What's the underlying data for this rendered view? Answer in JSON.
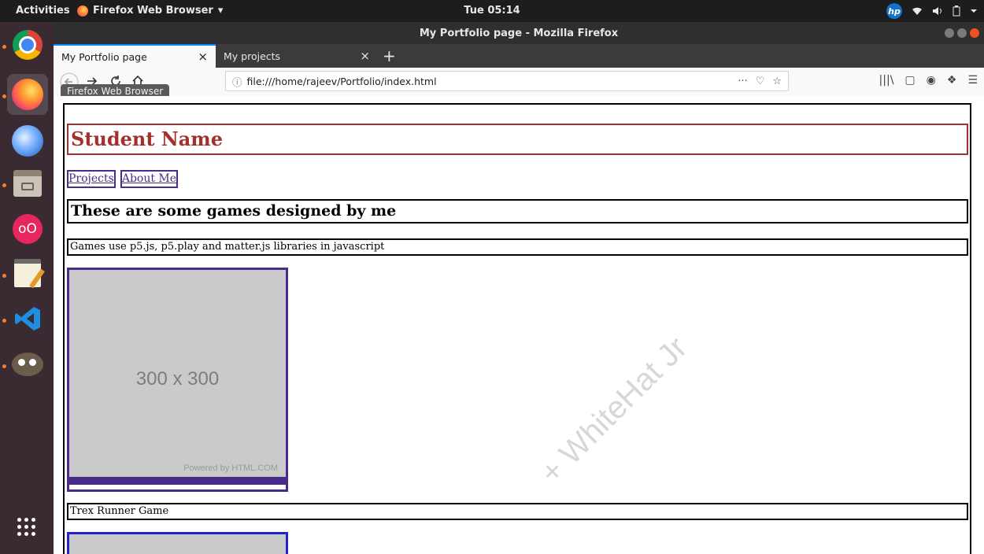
{
  "topbar": {
    "activities": "Activities",
    "app_menu_label": "Firefox Web Browser",
    "app_menu_arrow": "▾",
    "clock": "Tue 05:14",
    "tray_logo": "hp",
    "tray_icons": [
      "wifi-icon",
      "volume-icon",
      "battery-icon",
      "menu-arrow-icon"
    ]
  },
  "dock": {
    "items": [
      "chrome",
      "firefox",
      "thunderbird",
      "files",
      "oo",
      "text-editor",
      "vscode",
      "gimp"
    ],
    "oo_label": "oO"
  },
  "window": {
    "title": "My Portfolio page - Mozilla Firefox"
  },
  "tabs": [
    {
      "label": "My Portfolio page",
      "active": true
    },
    {
      "label": "My projects",
      "active": false
    }
  ],
  "tab_close_glyph": "×",
  "new_tab_glyph": "+",
  "navbar": {
    "url": "file:///home/rajeev/Portfolio/index.html",
    "tooltip": "Firefox Web Browser"
  },
  "page": {
    "student_name": "Student Name",
    "nav_links": [
      "Projects",
      "About Me"
    ],
    "section_heading": "These are some games designed by me",
    "description": "Games use p5.js, p5.play and matter.js libraries in javascript",
    "placeholder_size": "300 x 300",
    "placeholder_credit": "Powered by HTML.COM",
    "game_title": "Trex Runner Game"
  },
  "watermark": "+ WhiteHat Jr",
  "colors": {
    "heading": "#a2302c",
    "link": "#4b2b8a",
    "placeholder_border_2": "#2323c9",
    "dock_bg": "#3a2b33",
    "topbar_bg": "#1d1d1d"
  }
}
